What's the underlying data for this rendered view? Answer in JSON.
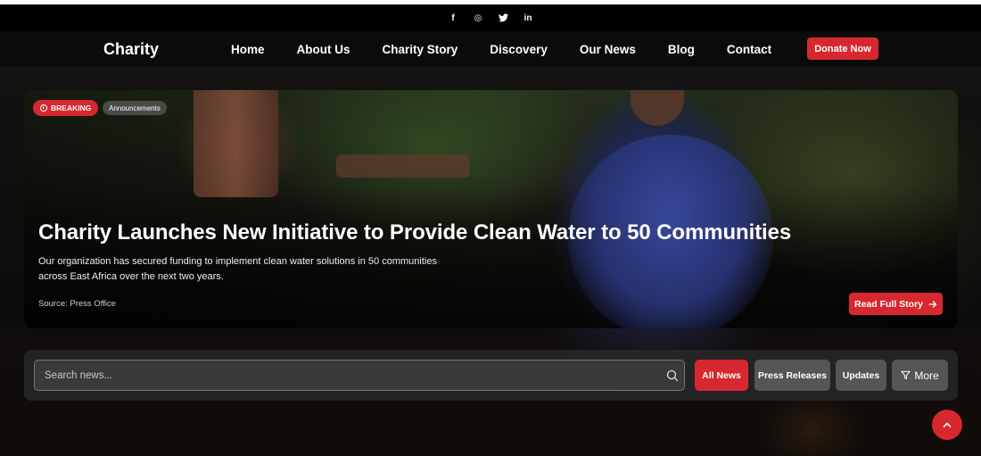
{
  "social": {
    "icons": [
      "facebook-icon",
      "instagram-icon",
      "twitter-icon",
      "linkedin-icon"
    ],
    "glyphs": [
      "f",
      "◎",
      "t",
      "in"
    ]
  },
  "nav": {
    "brand": "Charity",
    "links": [
      "Home",
      "About Us",
      "Charity Story",
      "Discovery",
      "Our News",
      "Blog",
      "Contact"
    ],
    "donate_label": "Donate Now"
  },
  "hero": {
    "breaking_label": "BREAKING",
    "category_label": "Announcements",
    "title": "Charity Launches New Initiative to Provide Clean Water to 50 Communities",
    "description": "Our organization has secured funding to implement clean water solutions in 50 communities across East Africa over the next two years.",
    "source": "Source: Press Office",
    "read_label": "Read Full Story"
  },
  "filters": {
    "search_placeholder": "Search news...",
    "all_news": "All News",
    "press_releases": "Press Releases",
    "updates": "Updates",
    "more": "More"
  },
  "colors": {
    "accent": "#d7282f",
    "chip_inactive": "#555555"
  }
}
